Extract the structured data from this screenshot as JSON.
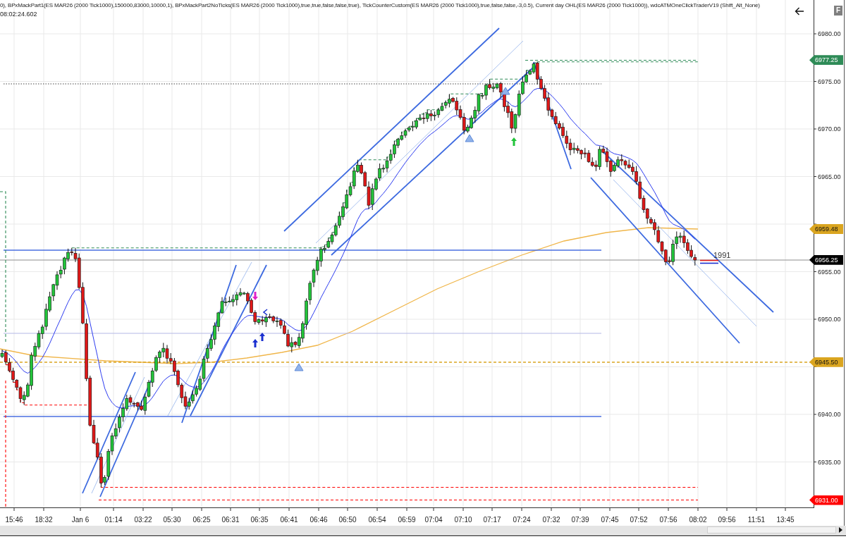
{
  "header": {
    "indicators": "0), BPxMackPart1(ES MAR26 (2000 Tick1000),150000,83000,10000,1), BPxMackPart2NoTicks(ES MAR26 (2000 Tick1000),true,true,false,false,true), TickCounterCustom(ES MAR26 (2000 Tick1000),true,false,false,-3,0.5), Current day OHL(ES MAR26 (2000 Tick1000)), wdcATMOneClickTraderV19 (Shift_Alt_None)",
    "timestamp": "08:02:24.602"
  },
  "toolbar": {
    "f_button": "F"
  },
  "chart": {
    "tick_counter": "1991",
    "price_axis": [
      "6980.00",
      "6975.00",
      "6970.00",
      "6965.00",
      "6955.00",
      "6950.00",
      "6940.00",
      "6935.00"
    ],
    "price_tags": [
      {
        "text": "6977.25",
        "color": "#2e8b57"
      },
      {
        "text": "6959.48",
        "color": "#daa520"
      },
      {
        "text": "6956.25",
        "color": "#000000"
      },
      {
        "text": "6945.50",
        "color": "#daa520"
      },
      {
        "text": "6931.00",
        "color": "#ff0000"
      }
    ],
    "time_axis": [
      "15:46",
      "18:32",
      "Jan 6",
      "01:14",
      "03:22",
      "05:30",
      "06:25",
      "06:31",
      "06:35",
      "06:41",
      "06:46",
      "06:50",
      "06:54",
      "06:59",
      "07:04",
      "07:10",
      "07:17",
      "07:24",
      "07:32",
      "07:39",
      "07:45",
      "07:52",
      "07:56",
      "08:02",
      "09:56",
      "11:51",
      "13:45"
    ]
  }
}
